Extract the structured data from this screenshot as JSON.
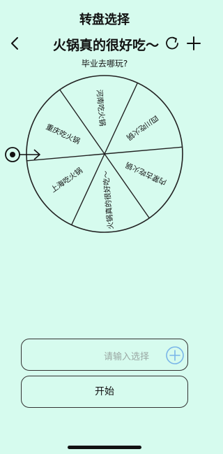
{
  "header": {
    "title": "转盘选择"
  },
  "nav": {
    "wheel_name": "火锅真的很好吃～"
  },
  "wheel": {
    "question": "毕业去哪玩?",
    "segments": [
      "河南吃火锅",
      "四川吃火锅",
      "内蒙古吃火锅",
      "火锅真的很好吃～",
      "上海吃火锅",
      "重庆吃火锅"
    ]
  },
  "input": {
    "placeholder": "请输入选择"
  },
  "start_button": {
    "label": "开始"
  },
  "icons": {
    "back": "chevron-left-icon",
    "refresh": "refresh-icon",
    "add": "plus-icon",
    "pointer": "pointer-icon",
    "input_add": "plus-circle-icon"
  },
  "colors": {
    "background": "#d6fbee",
    "accent": "#7ab6e8"
  }
}
